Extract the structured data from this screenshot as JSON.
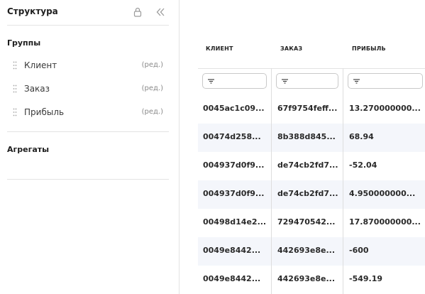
{
  "sidebar": {
    "title": "Структура",
    "groups_title": "Группы",
    "groups": [
      {
        "label": "Клиент",
        "edit": "(ред.)"
      },
      {
        "label": "Заказ",
        "edit": "(ред.)"
      },
      {
        "label": "Прибыль",
        "edit": "(ред.)"
      }
    ],
    "aggregates_title": "Агрегаты"
  },
  "table": {
    "columns": [
      "КЛИЕНТ",
      "ЗАКАЗ",
      "ПРИБЫЛЬ"
    ],
    "rows": [
      [
        "0045ac1c09...",
        "67f9754feff...",
        "13.270000000..."
      ],
      [
        "00474d258...",
        "8b388d845...",
        "68.94"
      ],
      [
        "004937d0f9...",
        "de74cb2fd7...",
        "-52.04"
      ],
      [
        "004937d0f9...",
        "de74cb2fd7...",
        "4.950000000..."
      ],
      [
        "00498d14e2...",
        "729470542...",
        "17.870000000..."
      ],
      [
        "0049e8442...",
        "442693e8e...",
        "-600"
      ],
      [
        "0049e8442...",
        "442693e8e...",
        "-549.19"
      ]
    ]
  },
  "icons": {
    "lock": "lock-icon",
    "collapse": "double-chevron-left-icon",
    "drag": "drag-handle-icon",
    "filter": "filter-icon"
  },
  "colors": {
    "row_alt": "#f4f6fb",
    "border": "#e3e3e3",
    "muted_text": "#8a8a8a"
  }
}
